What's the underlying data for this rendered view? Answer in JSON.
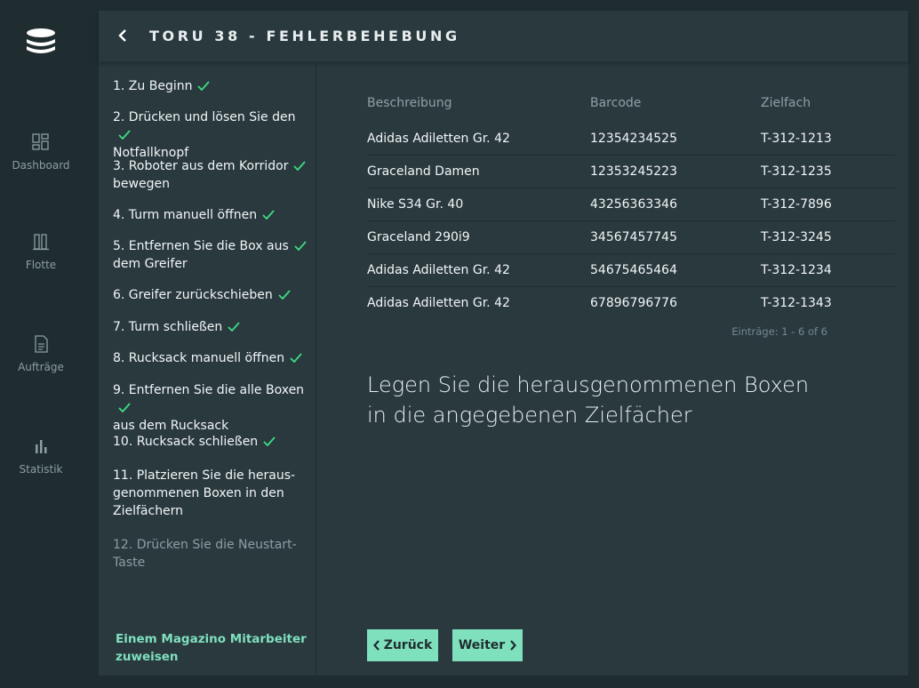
{
  "nav": {
    "items": [
      {
        "label": "Dashboard",
        "icon": "dashboard-icon"
      },
      {
        "label": "Flotte",
        "icon": "fleet-icon"
      },
      {
        "label": "Aufträge",
        "icon": "document-icon"
      },
      {
        "label": "Statistik",
        "icon": "bar-chart-icon"
      }
    ]
  },
  "header": {
    "title": "TORU 38 - FEHLERBEHEBUNG"
  },
  "steps": [
    {
      "label": "1. Zu Beginn",
      "done": true
    },
    {
      "label": "2. Drücken und lösen Sie den",
      "label2": "Notfallknopf",
      "done": true
    },
    {
      "label": "3. Roboter aus dem Korridor",
      "label2": "bewegen",
      "done": true
    },
    {
      "label": "4. Turm manuell öffnen",
      "done": true
    },
    {
      "label": "5. Entfernen Sie die Box aus",
      "label2": "dem Greifer",
      "done": true
    },
    {
      "label": "6. Greifer zurückschieben",
      "done": true
    },
    {
      "label": "7. Turm schließen",
      "done": true
    },
    {
      "label": "8. Rucksack manuell öffnen",
      "done": true
    },
    {
      "label": "9. Entfernen Sie die alle Boxen",
      "label2": "aus dem Rucksack",
      "done": true
    },
    {
      "label": "10. Rucksack schließen",
      "done": true
    },
    {
      "label": "11. Platzieren Sie die heraus-",
      "label2": "genommenen Boxen in den",
      "label3": "Zielfächern",
      "done": false
    },
    {
      "label": "12. Drücken Sie die Neustart-",
      "label2": "Taste",
      "done": false
    }
  ],
  "assign_link": {
    "line1": "Einem Magazino Mitarbeiter",
    "line2": "zuweisen"
  },
  "table": {
    "headers": [
      "Beschreibung",
      "Barcode",
      "Zielfach"
    ],
    "rows": [
      [
        "Adidas Adiletten Gr. 42",
        "12354234525",
        "T-312-1213"
      ],
      [
        "Graceland Damen",
        "12353245223",
        "T-312-1235"
      ],
      [
        "Nike S34 Gr. 40",
        "43256363346",
        "T-312-7896"
      ],
      [
        "Graceland 290i9",
        "34567457745",
        "T-312-3245"
      ],
      [
        "Adidas Adiletten Gr. 42",
        "54675465464",
        "T-312-1234"
      ],
      [
        "Adidas Adiletten Gr. 42",
        "67896796776",
        "T-312-1343"
      ]
    ],
    "pager": "Einträge:  1 - 6 of 6"
  },
  "instruction": {
    "line1": "Legen Sie die herausgenommenen Boxen",
    "line2": "in die angegebenen Zielfächer"
  },
  "buttons": {
    "back": "Zurück",
    "next": "Weiter"
  },
  "colors": {
    "accent": "#7fe0bd",
    "check": "#3ddc84",
    "panel": "#2a393e",
    "background": "#1f2c30"
  }
}
